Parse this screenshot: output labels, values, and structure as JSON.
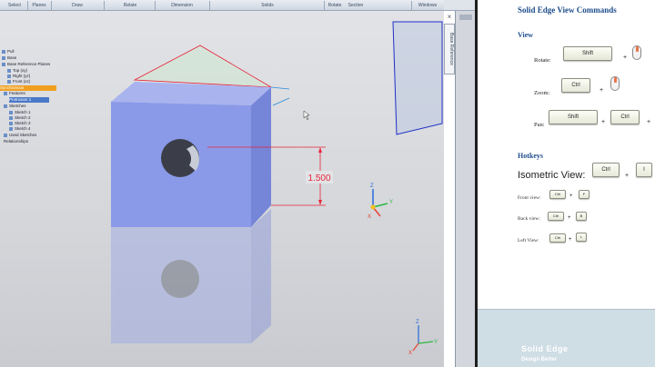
{
  "ribbon": {
    "groups": [
      "Select",
      "Planes",
      "Draw",
      "Relate",
      "Dimension",
      "Solids",
      "Rotate",
      "Section",
      "Windows"
    ]
  },
  "tree": {
    "items": [
      "Pull",
      "Base",
      "Base Reference Planes",
      "Top (xy)",
      "Right (yz)",
      "Front (xz)",
      "Synchronous",
      "Features",
      "Protrusion 1",
      "Sketches",
      "Sketch 1",
      "Sketch 2",
      "Sketch 3",
      "Sketch 4",
      "Used Sketches",
      "Relationships"
    ]
  },
  "viewport": {
    "dimension_value": "1.500",
    "triad_labels": {
      "x": "X",
      "y": "Y",
      "z": "Z"
    },
    "side_tab": "Base Reference"
  },
  "doc": {
    "title": "Solid Edge View Commands",
    "view_heading": "View",
    "rotate_label": "Rotate:",
    "zoom_label": "Zoom:",
    "pan_label": "Pan:",
    "shift_key": "Shift",
    "ctrl_key": "Ctrl",
    "plus": "+",
    "hotkeys_heading": "Hotkeys",
    "isometric_label": "Isometric View:",
    "iso_key2": "I",
    "front_label": "Front view:",
    "front_key": "F",
    "back_label": "Back view:",
    "back_key": "B",
    "left_label": "Left View:",
    "left_key": "L",
    "banner_title": "Solid Edge",
    "banner_sub": "Design Better"
  },
  "colors": {
    "cube_front": "#8a9ae8",
    "cube_top": "#a9b4ef",
    "cube_side": "#7585d8",
    "dimension": "#e8253a",
    "doc_heading": "#1f4e8c"
  }
}
